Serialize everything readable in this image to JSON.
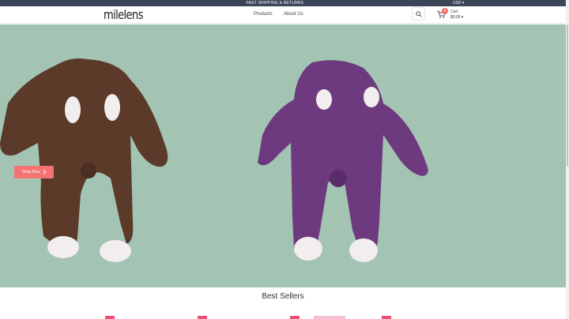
{
  "topbar": {
    "message": "FAST SHIPPING & RETURNS",
    "currency": "USD ▾"
  },
  "header": {
    "logo": "milelens",
    "nav": [
      "Products",
      "About Us"
    ],
    "cart": {
      "count": "0",
      "label": "Cart",
      "total": "$0.00 ▾"
    }
  },
  "hero": {
    "button_label": "Shop Now",
    "button_icon": "chevron-right-icon",
    "colors": {
      "background": "#a3c4b2",
      "button": "#f47272"
    }
  },
  "sections": {
    "best_sellers_title": "Best Sellers"
  }
}
